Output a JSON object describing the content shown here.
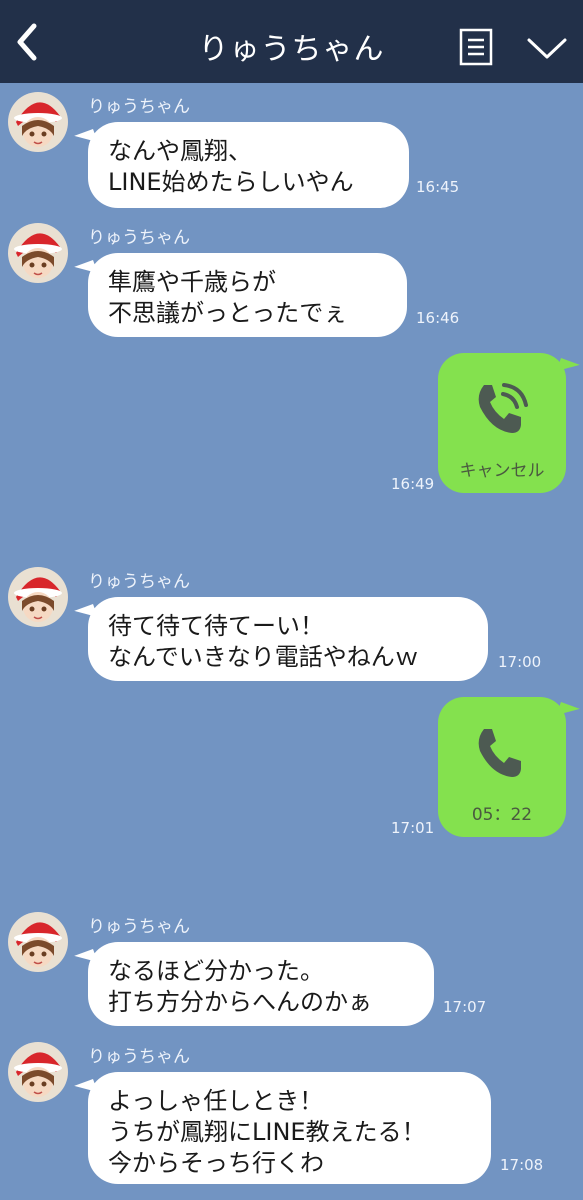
{
  "header": {
    "title": "りゅうちゃん",
    "back_icon": "chevron-left-icon",
    "notes_icon": "notes-icon",
    "menu_icon": "chevron-down-icon"
  },
  "colors": {
    "header_bg": "#223049",
    "chat_bg": "#7294c2",
    "incoming_bubble": "#ffffff",
    "outgoing_bubble": "#84e14e"
  },
  "messages": [
    {
      "sender": "りゅうちゃん",
      "text": "なんや鳳翔、\nLINE始めたらしいやん",
      "time": "16:45"
    },
    {
      "sender": "りゅうちゃん",
      "text": "隼鷹や千歳らが\n不思議がっとったでぇ",
      "time": "16:46"
    },
    {
      "call": true,
      "icon": "outgoing-call-icon",
      "label": "キャンセル",
      "time": "16:49"
    },
    {
      "sender": "りゅうちゃん",
      "text": "待て待て待てーい！\nなんでいきなり電話やねんｗ",
      "time": "17:00"
    },
    {
      "call": true,
      "icon": "phone-icon",
      "label": "05：22",
      "time": "17:01"
    },
    {
      "sender": "りゅうちゃん",
      "text": "なるほど分かった。\n打ち方分からへんのかぁ",
      "time": "17:07"
    },
    {
      "sender": "りゅうちゃん",
      "text": "よっしゃ任しとき！\nうちが鳳翔にLINE教えたる！\n今からそっち行くわ",
      "time": "17:08"
    }
  ]
}
